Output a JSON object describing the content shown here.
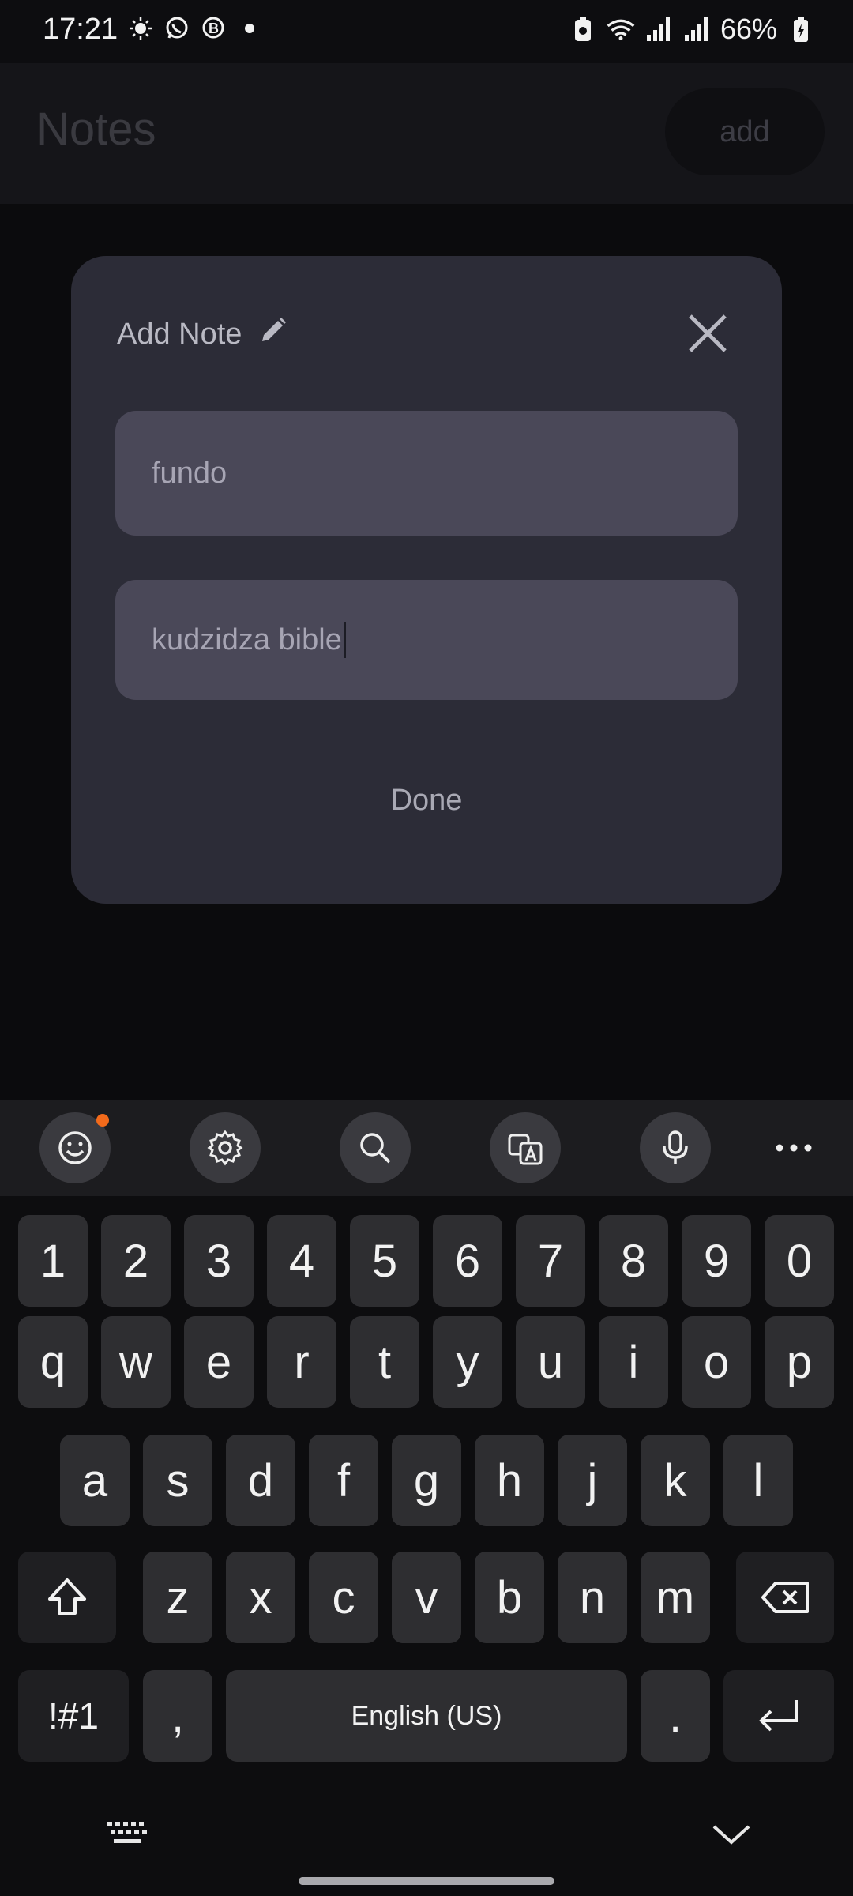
{
  "status": {
    "time": "17:21",
    "battery": "66%"
  },
  "header": {
    "title": "Notes",
    "add_label": "add"
  },
  "dialog": {
    "title": "Add Note",
    "title_value": "fundo",
    "body_value": "kudzidza bible",
    "done_label": "Done"
  },
  "keyboard": {
    "row_numbers": [
      "1",
      "2",
      "3",
      "4",
      "5",
      "6",
      "7",
      "8",
      "9",
      "0"
    ],
    "row_q": [
      "q",
      "w",
      "e",
      "r",
      "t",
      "y",
      "u",
      "i",
      "o",
      "p"
    ],
    "row_a": [
      "a",
      "s",
      "d",
      "f",
      "g",
      "h",
      "j",
      "k",
      "l"
    ],
    "row_z": [
      "z",
      "x",
      "c",
      "v",
      "b",
      "n",
      "m"
    ],
    "symbols_label": "!#1",
    "comma_label": ",",
    "space_label": "English (US)",
    "period_label": "."
  }
}
